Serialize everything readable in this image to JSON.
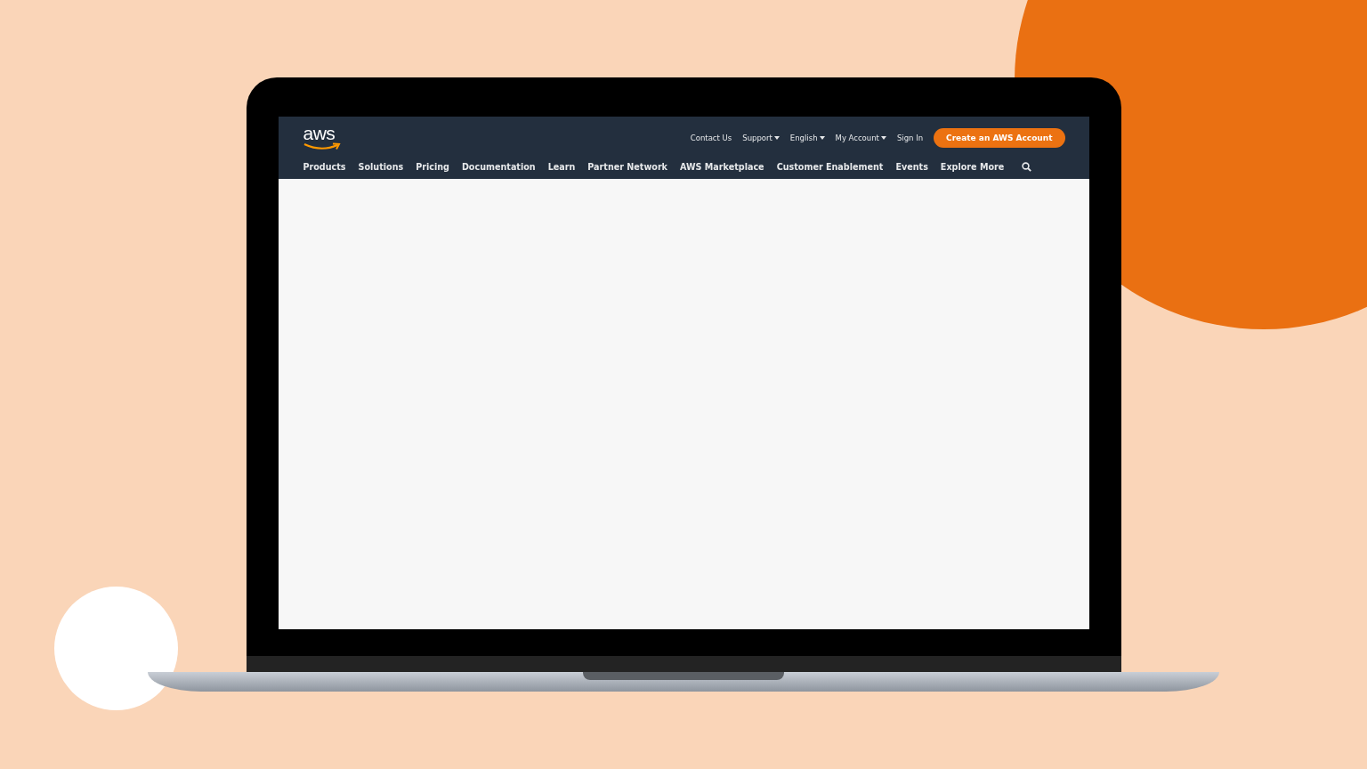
{
  "logo": "aws",
  "top_links": [
    {
      "label": "Contact Us",
      "dropdown": false
    },
    {
      "label": "Support",
      "dropdown": true
    },
    {
      "label": "English",
      "dropdown": true
    },
    {
      "label": "My Account",
      "dropdown": true
    },
    {
      "label": "Sign In",
      "dropdown": false
    }
  ],
  "cta_button": "Create an AWS Account",
  "nav_items": [
    "Products",
    "Solutions",
    "Pricing",
    "Documentation",
    "Learn",
    "Partner Network",
    "AWS Marketplace",
    "Customer Enablement",
    "Events",
    "Explore More"
  ]
}
